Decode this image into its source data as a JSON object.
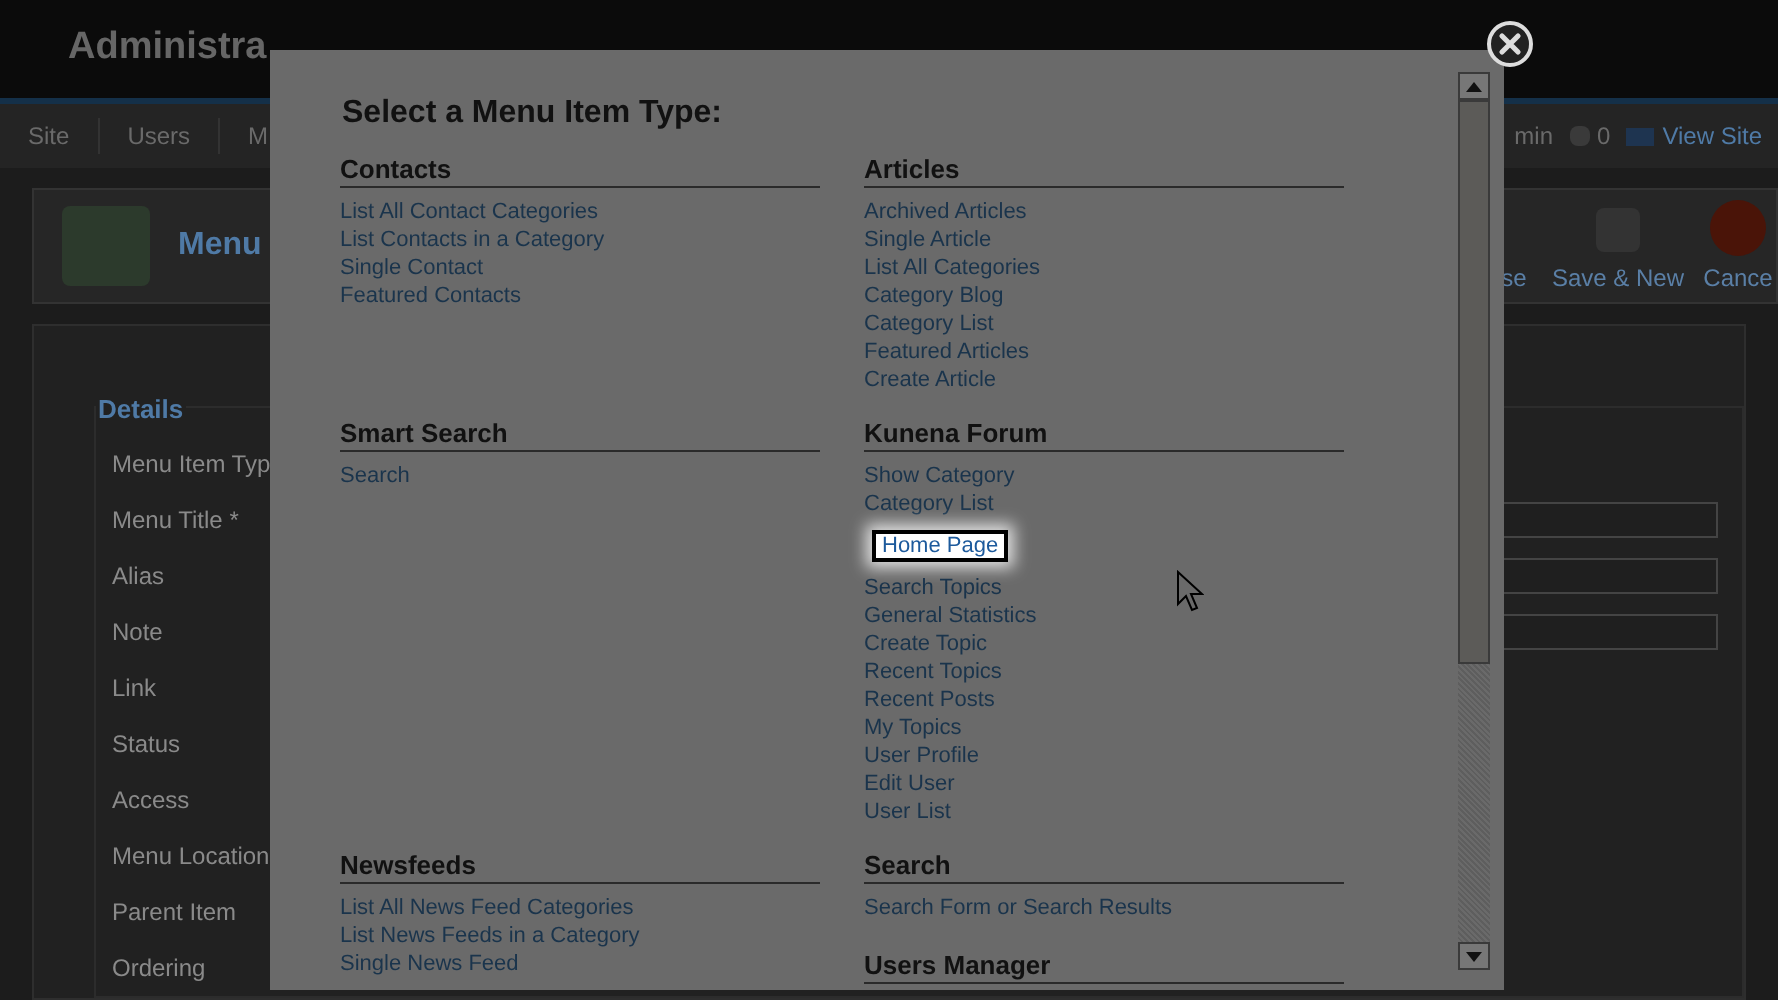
{
  "background": {
    "header_title": "Administra",
    "nav_items": [
      "Site",
      "Users",
      "M"
    ],
    "nav_right": [
      {
        "kind": "text",
        "label": "min"
      },
      {
        "kind": "count",
        "label": "0"
      },
      {
        "kind": "link",
        "label": "View Site"
      }
    ],
    "page_title": "Menu",
    "toolbar": [
      {
        "kind": "plain",
        "label": "se"
      },
      {
        "kind": "save",
        "label": "Save & New"
      },
      {
        "kind": "cancel",
        "label": "Cance"
      }
    ],
    "fieldset_legend": "Details",
    "fields": [
      {
        "label": "Menu Item Typ",
        "input": false
      },
      {
        "label": "Menu Title *",
        "input": true
      },
      {
        "label": "Alias",
        "input": true
      },
      {
        "label": "Note",
        "input": true
      },
      {
        "label": "Link",
        "input": false
      },
      {
        "label": "Status",
        "input": false
      },
      {
        "label": "Access",
        "input": false
      },
      {
        "label": "Menu Location",
        "input": false
      },
      {
        "label": "Parent Item",
        "input": false
      },
      {
        "label": "Ordering",
        "input": false
      }
    ]
  },
  "modal": {
    "title": "Select a Menu Item Type:",
    "rows": [
      [
        [
          {
            "heading": "Contacts",
            "items": [
              {
                "label": "List All Contact Categories",
                "highlighted": false
              },
              {
                "label": "List Contacts in a Category",
                "highlighted": false
              },
              {
                "label": "Single Contact",
                "highlighted": false
              },
              {
                "label": "Featured Contacts",
                "highlighted": false
              }
            ]
          }
        ],
        [
          {
            "heading": "Articles",
            "items": [
              {
                "label": "Archived Articles",
                "highlighted": false
              },
              {
                "label": "Single Article",
                "highlighted": false
              },
              {
                "label": "List All Categories",
                "highlighted": false
              },
              {
                "label": "Category Blog",
                "highlighted": false
              },
              {
                "label": "Category List",
                "highlighted": false
              },
              {
                "label": "Featured Articles",
                "highlighted": false
              },
              {
                "label": "Create Article",
                "highlighted": false
              }
            ]
          }
        ]
      ],
      [
        [
          {
            "heading": "Smart Search",
            "items": [
              {
                "label": "Search",
                "highlighted": false
              }
            ]
          }
        ],
        [
          {
            "heading": "Kunena Forum",
            "items": [
              {
                "label": "Show Category",
                "highlighted": false
              },
              {
                "label": "Category List",
                "highlighted": false
              },
              {
                "label": "Home Page",
                "highlighted": true
              },
              {
                "label": "Search Topics",
                "highlighted": false
              },
              {
                "label": "General Statistics",
                "highlighted": false
              },
              {
                "label": "Create Topic",
                "highlighted": false
              },
              {
                "label": "Recent Topics",
                "highlighted": false
              },
              {
                "label": "Recent Posts",
                "highlighted": false
              },
              {
                "label": "My Topics",
                "highlighted": false
              },
              {
                "label": "User Profile",
                "highlighted": false
              },
              {
                "label": "Edit User",
                "highlighted": false
              },
              {
                "label": "User List",
                "highlighted": false
              }
            ]
          }
        ]
      ],
      [
        [
          {
            "heading": "Newsfeeds",
            "items": [
              {
                "label": "List All News Feed Categories",
                "highlighted": false
              },
              {
                "label": "List News Feeds in a Category",
                "highlighted": false
              },
              {
                "label": "Single News Feed",
                "highlighted": false
              }
            ]
          }
        ],
        [
          {
            "heading": "Search",
            "items": [
              {
                "label": "Search Form or Search Results",
                "highlighted": false
              }
            ]
          },
          {
            "heading": "Users Manager"
          }
        ]
      ]
    ]
  }
}
